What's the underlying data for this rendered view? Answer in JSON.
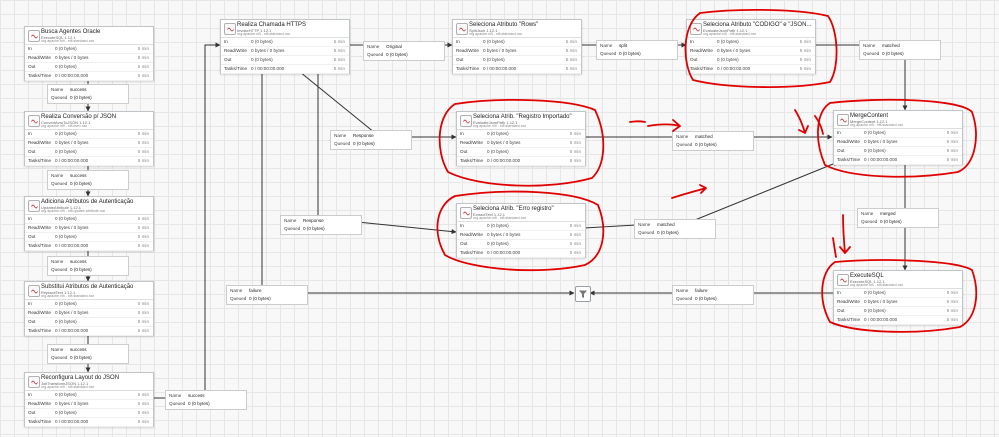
{
  "colors": {
    "accent_annotation": "#e00000",
    "edge": "#333333",
    "node_border": "#bfc5c9"
  },
  "stat_labels": {
    "in": "In",
    "rw": "Read/Write",
    "out": "Out",
    "tasks": "Tasks/Time"
  },
  "conn_labels": {
    "name": "Name",
    "queued": "Queued"
  },
  "processors": [
    {
      "name": "Busca Agentes Oracle",
      "type": "ExecuteSQL 1.12.1",
      "bundle": "org.apache.nifi - nifi-standard-nar",
      "in": "0 (0 bytes)",
      "rw": "0 bytes / 0 bytes",
      "out": "0 (0 bytes)",
      "tasks": "0 / 00:00:00.000",
      "window": "5 min"
    },
    {
      "name": "Realiza Conversão p/ JSON",
      "type": "ConvertAvroToJSON 1.12.1",
      "bundle": "org.apache.nifi - nifi-avro-nar",
      "in": "0 (0 bytes)",
      "rw": "0 bytes / 0 bytes",
      "out": "0 (0 bytes)",
      "tasks": "0 / 00:00:00.000",
      "window": "5 min"
    },
    {
      "name": "Adiciona Atributos de Autenticação",
      "type": "UpdateAttribute 1.12.1",
      "bundle": "org.apache.nifi - nifi-update-attribute-nar",
      "in": "0 (0 bytes)",
      "rw": "0 bytes / 0 bytes",
      "out": "0 (0 bytes)",
      "tasks": "0 / 00:00:00.000",
      "window": "5 min"
    },
    {
      "name": "Substitui Atributos de Autenticação",
      "type": "ReplaceText 1.12.1",
      "bundle": "org.apache.nifi - nifi-standard-nar",
      "in": "0 (0 bytes)",
      "rw": "0 bytes / 0 bytes",
      "out": "0 (0 bytes)",
      "tasks": "0 / 00:00:00.000",
      "window": "5 min"
    },
    {
      "name": "Reconfigura Layout do JSON",
      "type": "JoltTransformJSON 1.12.1",
      "bundle": "org.apache.nifi - nifi-standard-nar",
      "in": "0 (0 bytes)",
      "rw": "0 bytes / 0 bytes",
      "out": "0 (0 bytes)",
      "tasks": "0 / 00:00:00.000",
      "window": "5 min"
    },
    {
      "name": "Realiza Chamada HTTPS",
      "type": "InvokeHTTP 1.12.1",
      "bundle": "org.apache.nifi - nifi-standard-nar",
      "in": "0 (0 bytes)",
      "rw": "0 bytes / 0 bytes",
      "out": "0 (0 bytes)",
      "tasks": "0 / 00:00:00.000",
      "window": "5 min"
    },
    {
      "name": "Seleciona Atributo \"Rows\"",
      "type": "SplitJson 1.12.1",
      "bundle": "org.apache.nifi - nifi-standard-nar",
      "in": "0 (0 bytes)",
      "rw": "0 bytes / 0 bytes",
      "out": "0 (0 bytes)",
      "tasks": "0 / 00:00:00.000",
      "window": "5 min"
    },
    {
      "name": "Seleciona Atributo \"CODIGO\" e \"JSON...",
      "type": "EvaluateJsonPath 1.12.1",
      "bundle": "org.apache.nifi - nifi-standard-nar",
      "in": "0 (0 bytes)",
      "rw": "0 bytes / 0 bytes",
      "out": "0 (0 bytes)",
      "tasks": "0 / 00:00:00.000",
      "window": "5 min"
    },
    {
      "name": "Seleciona Atrib. \"Registro Importado\"",
      "type": "EvaluateJsonPath 1.12.1",
      "bundle": "org.apache.nifi - nifi-standard-nar",
      "in": "0 (0 bytes)",
      "rw": "0 bytes / 0 bytes",
      "out": "0 (0 bytes)",
      "tasks": "0 / 00:00:00.000",
      "window": "5 min"
    },
    {
      "name": "Seleciona Atrib. \"Erro registro\"",
      "type": "ExtractText 1.12.1",
      "bundle": "org.apache.nifi - nifi-standard-nar",
      "in": "0 (0 bytes)",
      "rw": "0 bytes / 0 bytes",
      "out": "0 (0 bytes)",
      "tasks": "0 / 00:00:00.000",
      "window": "5 min"
    },
    {
      "name": "MergeContent",
      "type": "MergeContent 1.12.1",
      "bundle": "org.apache.nifi - nifi-standard-nar",
      "in": "0 (0 bytes)",
      "rw": "0 bytes / 0 bytes",
      "out": "0 (0 bytes)",
      "tasks": "0 / 00:00:00.000",
      "window": "5 min"
    },
    {
      "name": "ExecuteSQL",
      "type": "ExecuteSQL 1.12.1",
      "bundle": "org.apache.nifi - nifi-standard-nar",
      "in": "0 (0 bytes)",
      "rw": "0 bytes / 0 bytes",
      "out": "0 (0 bytes)",
      "tasks": "0 / 00:00:00.000",
      "window": "5 min"
    }
  ],
  "connections": [
    {
      "name": "success",
      "queued": "0 (0 bytes)"
    },
    {
      "name": "success",
      "queued": "0 (0 bytes)"
    },
    {
      "name": "success",
      "queued": "0 (0 bytes)"
    },
    {
      "name": "success",
      "queued": "0 (0 bytes)"
    },
    {
      "name": "success",
      "queued": "0 (0 bytes)"
    },
    {
      "name": "Original",
      "queued": "0 (0 bytes)"
    },
    {
      "name": "split",
      "queued": "0 (0 bytes)"
    },
    {
      "name": "matched",
      "queued": "0 (0 bytes)"
    },
    {
      "name": "Response",
      "queued": "0 (0 bytes)"
    },
    {
      "name": "matched",
      "queued": "0 (0 bytes)"
    },
    {
      "name": "Response",
      "queued": "0 (0 bytes)"
    },
    {
      "name": "matched",
      "queued": "0 (0 bytes)"
    },
    {
      "name": "merged",
      "queued": "0 (0 bytes)"
    },
    {
      "name": "failure",
      "queued": "0 (0 bytes)"
    },
    {
      "name": "failure",
      "queued": "0 (0 bytes)"
    }
  ]
}
